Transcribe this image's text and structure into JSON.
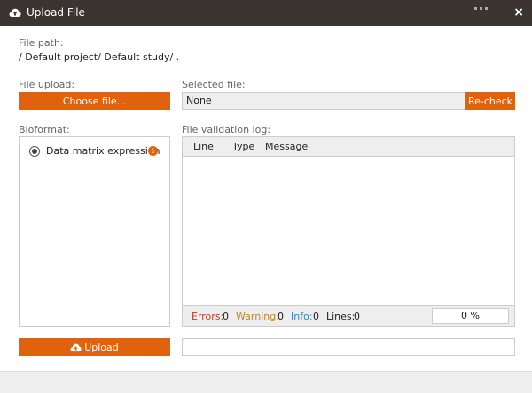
{
  "titlebar": {
    "icon": "cloud-upload-icon",
    "title": "Upload File",
    "close_label": "×",
    "bg_color": "#3b3430"
  },
  "file_path": {
    "label": "File path:",
    "value": "/ Default project/ Default study/ ."
  },
  "file_upload": {
    "label": "File upload:",
    "button_label": "Choose file..."
  },
  "selected_file": {
    "label": "Selected file:",
    "value": "None",
    "recheck_label": "Re-check"
  },
  "bioformat": {
    "label": "Bioformat:",
    "options": [
      {
        "label": "Data matrix expression",
        "selected": true,
        "icon": "info-icon"
      }
    ]
  },
  "validation_log": {
    "label": "File validation log:",
    "columns": [
      "Line",
      "Type",
      "Message"
    ],
    "rows": [],
    "stats": {
      "errors_label": "Errors:",
      "errors_value": "0",
      "warning_label": "Warning:",
      "warning_value": "0",
      "info_label": "Info:",
      "info_value": "0",
      "lines_label": "Lines:",
      "lines_value": "0"
    },
    "progress_text": "0 %",
    "progress_fraction": 0
  },
  "upload": {
    "icon": "cloud-upload-icon",
    "button_label": "Upload"
  },
  "status_field": {
    "value": ""
  },
  "colors": {
    "accent": "#e0620d",
    "errors": "#c0392b",
    "warning": "#b8892e",
    "info": "#3a7fc1"
  }
}
